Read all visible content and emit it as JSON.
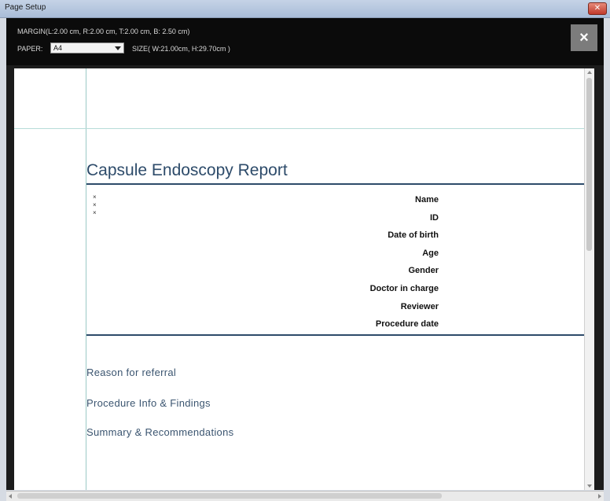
{
  "window": {
    "title": "Page Setup",
    "close_glyph": "✕"
  },
  "header": {
    "margin_text": "MARGIN(L:2.00 cm, R:2.00 cm, T:2.00 cm, B: 2.50 cm)",
    "paper_label": "PAPER:",
    "paper_value": "A4",
    "size_text": "SIZE( W:21.00cm, H:29.70cm )",
    "close_glyph": "×"
  },
  "report": {
    "title": "Capsule Endoscopy Report",
    "bullets": [
      "×",
      "×",
      "×"
    ],
    "fields": [
      "Name",
      "ID",
      "Date of birth",
      "Age",
      "Gender",
      "Doctor in charge",
      "Reviewer",
      "Procedure date"
    ],
    "sections": [
      "Reason for referral",
      "Procedure Info & Findings",
      "Summary & Recommendations"
    ]
  },
  "colors": {
    "accent": "#2d4b6a",
    "header_bg": "#0b0b0b",
    "guide_line": "#9cc9c6"
  }
}
